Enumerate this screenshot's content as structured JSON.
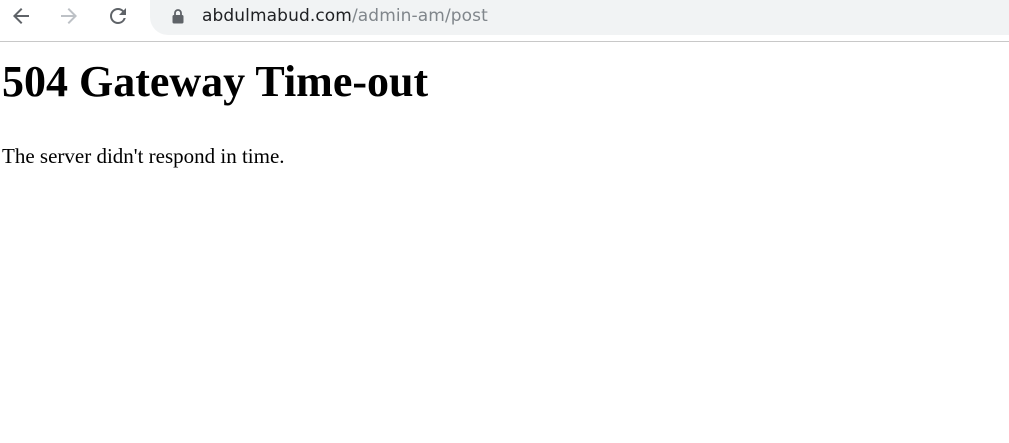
{
  "browser": {
    "url_host": "abdulmabud.com",
    "url_path": "/admin-am/post",
    "icons": {
      "back": "arrow-left-icon",
      "forward": "arrow-right-icon",
      "reload": "reload-icon",
      "lock": "lock-icon"
    },
    "colors": {
      "omnibox_bg": "#f1f3f4",
      "url_host": "#202124",
      "url_path": "#80868b",
      "back_icon": "#5f6368",
      "forward_icon": "#bdc1c6"
    }
  },
  "page": {
    "title": "504 Gateway Time-out",
    "message": "The server didn't respond in time."
  }
}
